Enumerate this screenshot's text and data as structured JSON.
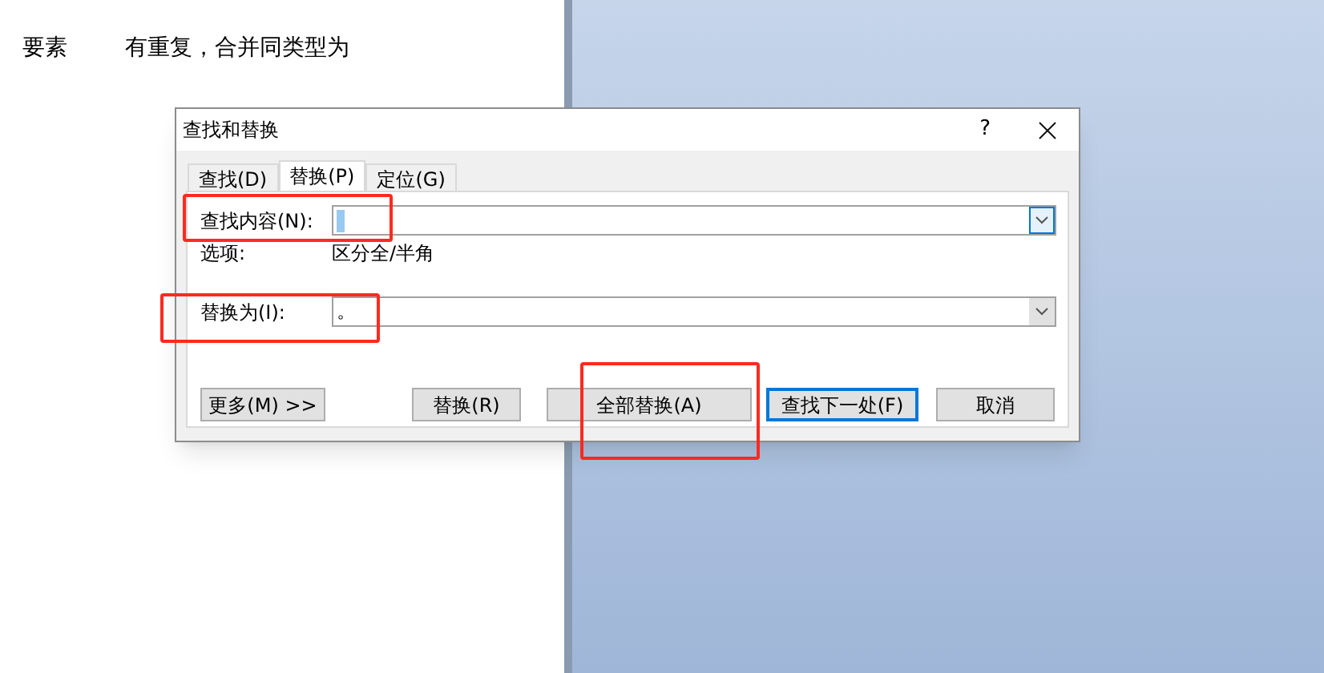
{
  "document": {
    "lines": [
      {
        "parts": [
          "要素",
          "有重复，合并同类型为"
        ]
      }
    ]
  },
  "dialog": {
    "title": "查找和替换",
    "help": "?",
    "tabs": [
      {
        "label": "查找(D)",
        "selected": false
      },
      {
        "label": "替换(P)",
        "selected": true
      },
      {
        "label": "定位(G)",
        "selected": false
      }
    ],
    "find": {
      "label": "查找内容(N):",
      "focused": true
    },
    "options": {
      "label": "选项:",
      "value": "区分全/半角"
    },
    "replace": {
      "label": "替换为(I):",
      "value": "。",
      "focused": false
    },
    "buttons": [
      {
        "label": "更多(M) >>",
        "default": false
      },
      {
        "label": "替换(R)",
        "default": false
      },
      {
        "label": "全部替换(A)",
        "default": false
      },
      {
        "label": "查找下一处(F)",
        "default": true
      },
      {
        "label": "取消",
        "default": false
      }
    ]
  }
}
